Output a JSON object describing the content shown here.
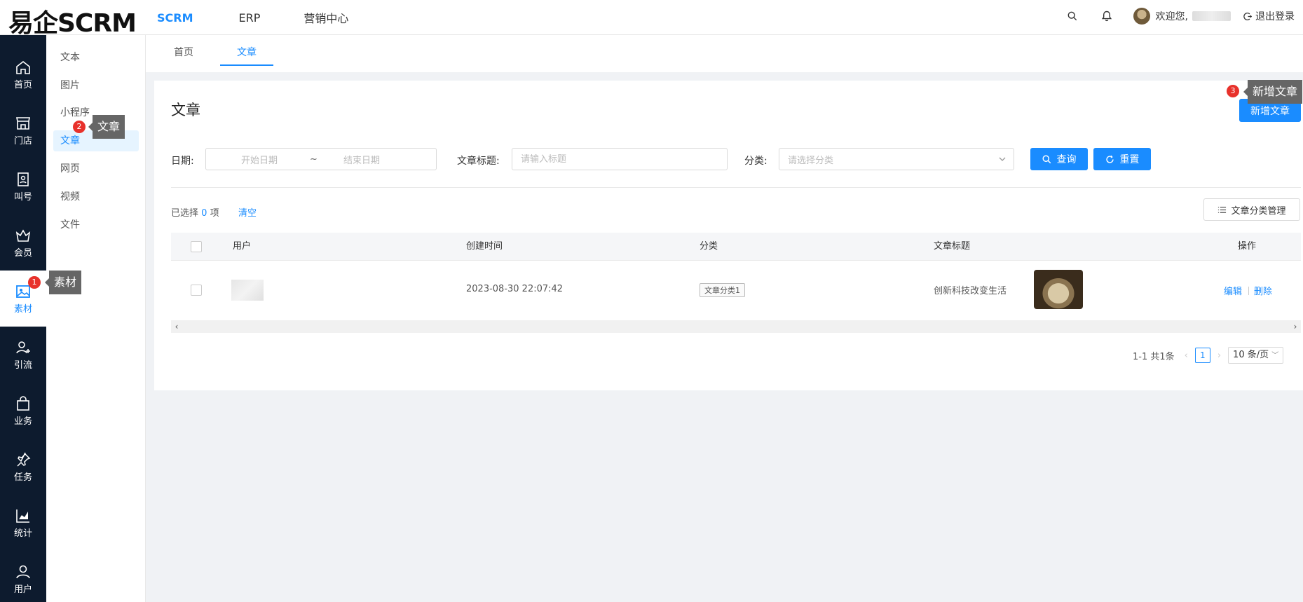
{
  "header": {
    "logo": "易企SCRM",
    "nav": [
      "SCRM",
      "ERP",
      "营销中心"
    ],
    "active_nav": "SCRM",
    "welcome": "欢迎您,",
    "logout": "退出登录"
  },
  "sidebar": {
    "items": [
      {
        "label": "首页",
        "icon": "home-icon"
      },
      {
        "label": "门店",
        "icon": "store-icon"
      },
      {
        "label": "叫号",
        "icon": "queue-icon"
      },
      {
        "label": "会员",
        "icon": "crown-icon"
      },
      {
        "label": "素材",
        "icon": "image-icon"
      },
      {
        "label": "引流",
        "icon": "user-plus-icon"
      },
      {
        "label": "业务",
        "icon": "bag-icon"
      },
      {
        "label": "任务",
        "icon": "pin-icon"
      },
      {
        "label": "统计",
        "icon": "chart-icon"
      },
      {
        "label": "用户",
        "icon": "user-icon"
      }
    ],
    "active": "素材"
  },
  "submenu": {
    "items": [
      "文本",
      "图片",
      "小程序",
      "文章",
      "网页",
      "视频",
      "文件"
    ],
    "active": "文章"
  },
  "tabs": [
    "首页",
    "文章"
  ],
  "active_tab": "文章",
  "page": {
    "title": "文章",
    "add_button": "新增文章"
  },
  "filters": {
    "date_label": "日期:",
    "start_placeholder": "开始日期",
    "separator": "~",
    "end_placeholder": "结束日期",
    "title_label": "文章标题:",
    "title_placeholder": "请输入标题",
    "category_label": "分类:",
    "category_placeholder": "请选择分类",
    "search_button": "查询",
    "reset_button": "重置"
  },
  "selection": {
    "prefix": "已选择",
    "count": "0",
    "suffix": "项",
    "clear": "清空",
    "category_manage": "文章分类管理"
  },
  "table": {
    "columns": [
      "用户",
      "创建时间",
      "分类",
      "文章标题",
      "操作"
    ],
    "rows": [
      {
        "created": "2023-08-30 22:07:42",
        "category": "文章分类1",
        "title": "创新科技改变生活",
        "actions": [
          "编辑",
          "删除"
        ]
      }
    ]
  },
  "pagination": {
    "summary": "1-1 共1条",
    "current_page": "1",
    "page_size": "10 条/页"
  },
  "annotations": [
    {
      "num": "1",
      "text": "素材"
    },
    {
      "num": "2",
      "text": "文章"
    },
    {
      "num": "3",
      "text": "新增文章"
    }
  ],
  "colors": {
    "primary": "#1a8cff",
    "sidebar_bg": "#0d1b2e",
    "badge": "#e8312b"
  }
}
